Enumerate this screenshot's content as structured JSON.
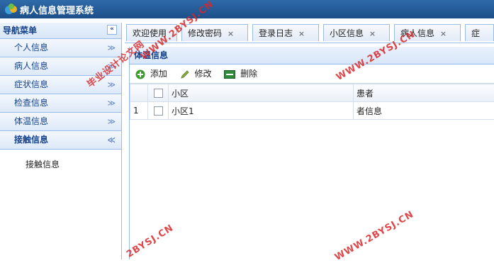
{
  "header": {
    "title": "病人信息管理系统"
  },
  "sidebar": {
    "title": "导航菜单",
    "collapse_label": "«",
    "items": [
      {
        "label": "个人信息",
        "chev": "≫"
      },
      {
        "label": "病人信息",
        "chev": "≫"
      },
      {
        "label": "症状信息",
        "chev": "≫"
      },
      {
        "label": "检查信息",
        "chev": "≫"
      },
      {
        "label": "体温信息",
        "chev": "≫"
      },
      {
        "label": "接触信息",
        "chev": "≪"
      }
    ],
    "submenu": [
      "接触信息"
    ]
  },
  "tabs": [
    {
      "label": "欢迎使用",
      "close": ""
    },
    {
      "label": "修改密码",
      "close": "×"
    },
    {
      "label": "登录日志",
      "close": "×"
    },
    {
      "label": "小区信息",
      "close": "×"
    },
    {
      "label": "病人信息",
      "close": "×"
    },
    {
      "label": "症",
      "close": ""
    }
  ],
  "panel": {
    "title": "体温信息",
    "toolbar": {
      "add": "添加",
      "edit": "修改",
      "delete": "删除"
    },
    "columns": [
      "小区",
      "患者"
    ],
    "rows": [
      {
        "num": "1",
        "cells": [
          "小区1",
          "者信息"
        ]
      }
    ]
  },
  "watermark": {
    "text1": "毕业设计论文网",
    "text2": "WWW.2BYSJ.CN",
    "text3": "2BYSJ.CN",
    "text4": "WWW.2BYSJ.CN",
    "text5": "WWW.2BYSJ.CN"
  }
}
